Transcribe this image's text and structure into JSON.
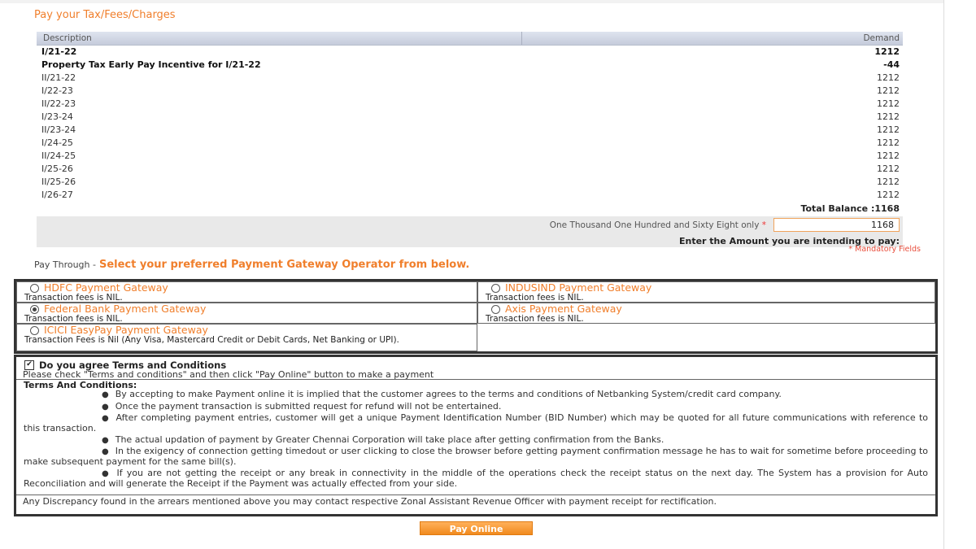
{
  "page": {
    "title": "Pay your Tax/Fees/Charges"
  },
  "table": {
    "headers": {
      "description": "Description",
      "demand": "Demand"
    },
    "rows": [
      {
        "description": "I/21-22",
        "amount": "1212",
        "bold": true
      },
      {
        "description": "Property Tax Early Pay Incentive for I/21-22",
        "amount": "-44",
        "bold": true
      },
      {
        "description": "II/21-22",
        "amount": "1212",
        "bold": false
      },
      {
        "description": "I/22-23",
        "amount": "1212",
        "bold": false
      },
      {
        "description": "II/22-23",
        "amount": "1212",
        "bold": false
      },
      {
        "description": "I/23-24",
        "amount": "1212",
        "bold": false
      },
      {
        "description": "II/23-24",
        "amount": "1212",
        "bold": false
      },
      {
        "description": "I/24-25",
        "amount": "1212",
        "bold": false
      },
      {
        "description": "II/24-25",
        "amount": "1212",
        "bold": false
      },
      {
        "description": "I/25-26",
        "amount": "1212",
        "bold": false
      },
      {
        "description": "II/25-26",
        "amount": "1212",
        "bold": false
      },
      {
        "description": "I/26-27",
        "amount": "1212",
        "bold": false
      }
    ],
    "total_label": "Total Balance :1168"
  },
  "amount": {
    "words": "One Thousand One Hundred and Sixty Eight only",
    "required_marker": "*",
    "value": "1168",
    "prompt": "Enter the Amount you are intending to pay:",
    "mandatory_note": "* Mandatory Fields"
  },
  "pay_through": {
    "label": "Pay Through -",
    "instruction": "Select your preferred Payment Gateway Operator from below."
  },
  "gateways": {
    "hdfc": {
      "name": "HDFC Payment Gateway",
      "fee": "Transaction fees is NIL.",
      "selected": false
    },
    "indusind": {
      "name": "INDUSIND Payment Gateway",
      "fee": "Transaction fees is NIL.",
      "selected": false
    },
    "federal": {
      "name": "Federal Bank Payment Gateway",
      "fee": "Transaction fees is NIL.",
      "selected": true
    },
    "axis": {
      "name": "Axis Payment Gateway",
      "fee": "Transaction fees is NIL.",
      "selected": false
    },
    "icici": {
      "name": "ICICI EasyPay Payment Gateway",
      "fee": "Transaction Fees is Nil (Any Visa, Mastercard Credit or Debit Cards, Net Banking or UPI).",
      "selected": false
    }
  },
  "terms": {
    "agree_label": "Do you agree Terms and Conditions",
    "agree_checked": true,
    "agree_hint": "Please check \"Terms and conditions\" and then click \"Pay Online\" button to make a payment",
    "heading": "Terms And Conditions:",
    "items": [
      "By accepting to make Payment online it is implied that the customer agrees to the terms and conditions of Netbanking System/credit card company.",
      "Once the payment transaction is submitted request for refund will not be entertained.",
      "After completing payment entries, customer will get a unique Payment Identification Number (BID Number) which may be quoted for all future communications with reference to this transaction.",
      "The actual updation of payment by Greater Chennai Corporation will take place after getting confirmation from the Banks.",
      "In the exigency of connection getting timedout or user clicking to close the browser before getting payment confirmation message he has to wait for sometime before proceeding to make subsequent payment for the same bill(s).",
      "If you are not getting the receipt or any break in connectivity in the middle of the operations check the receipt status on the next day. The System has a provision for Auto Reconciliation and will generate the Receipt if the Payment was actually effected from your side."
    ],
    "discrepancy": "Any Discrepancy found in the arrears mentioned above you may contact respective Zonal Assistant Revenue Officer with payment receipt for rectification."
  },
  "actions": {
    "pay_online": "Pay Online"
  },
  "colors": {
    "accent": "#f07f2c",
    "button": "#f18a1e",
    "header_bg": "#c5cbdb"
  }
}
